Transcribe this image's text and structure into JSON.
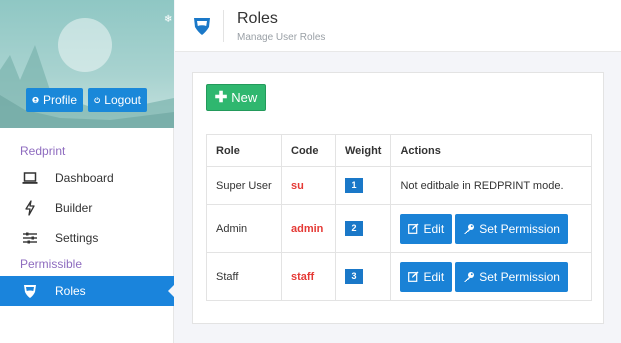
{
  "sidebar": {
    "buttons": {
      "profile": "Profile",
      "logout": "Logout"
    },
    "sections": [
      {
        "label": "Redprint"
      },
      {
        "label": "Permissible"
      }
    ],
    "items": [
      {
        "label": "Dashboard",
        "icon": "laptop-icon"
      },
      {
        "label": "Builder",
        "icon": "bolt-icon"
      },
      {
        "label": "Settings",
        "icon": "sliders-icon"
      },
      {
        "label": "Roles",
        "icon": "shield-icon",
        "active": true
      }
    ]
  },
  "header": {
    "title": "Roles",
    "subtitle": "Manage User Roles"
  },
  "main": {
    "new_button": "New",
    "table": {
      "columns": [
        "Role",
        "Code",
        "Weight",
        "Actions"
      ],
      "rows": [
        {
          "role": "Super User",
          "code": "su",
          "weight": "1",
          "note": "Not editbale in REDPRINT mode."
        },
        {
          "role": "Admin",
          "code": "admin",
          "weight": "2",
          "edit": "Edit",
          "permission": "Set Permission"
        },
        {
          "role": "Staff",
          "code": "staff",
          "weight": "3",
          "edit": "Edit",
          "permission": "Set Permission"
        }
      ]
    }
  },
  "colors": {
    "accent": "#1a84dc",
    "success": "#2fb76f",
    "code": "#e53935",
    "section": "#8e6bbf"
  }
}
